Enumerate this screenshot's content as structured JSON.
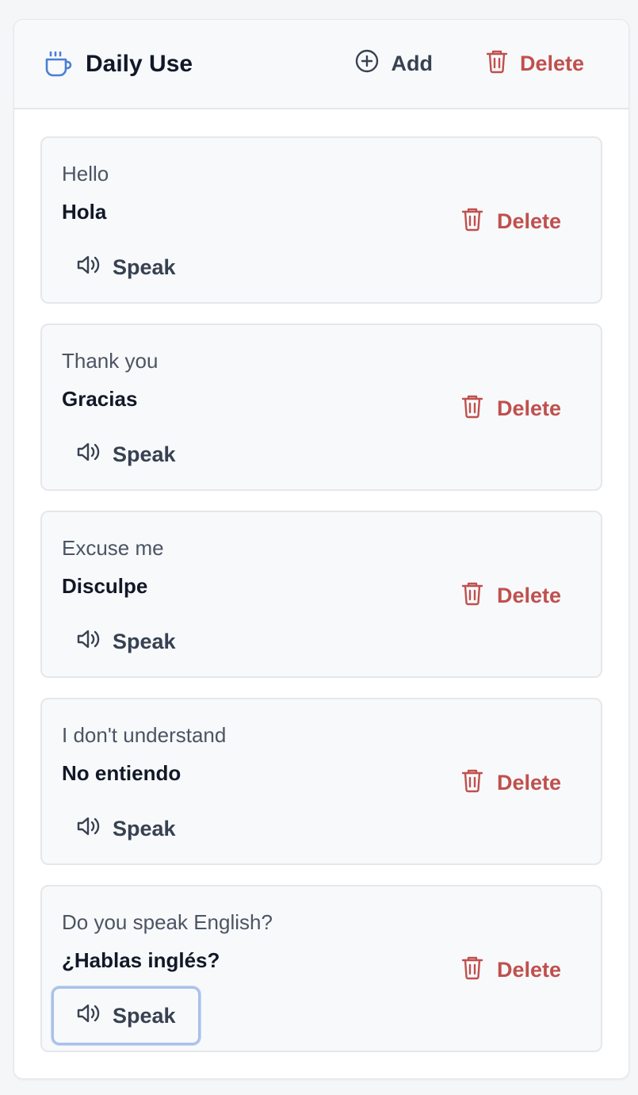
{
  "header": {
    "title": "Daily Use",
    "title_icon": "coffee-cup-icon",
    "add_label": "Add",
    "delete_label": "Delete"
  },
  "colors": {
    "accent": "#4a7fd4",
    "danger": "#c0504d",
    "text": "#111827",
    "muted": "#4b5563"
  },
  "phrases": [
    {
      "english": "Hello",
      "spanish": "Hola",
      "speak_label": "Speak",
      "delete_label": "Delete"
    },
    {
      "english": "Thank you",
      "spanish": "Gracias",
      "speak_label": "Speak",
      "delete_label": "Delete"
    },
    {
      "english": "Excuse me",
      "spanish": "Disculpe",
      "speak_label": "Speak",
      "delete_label": "Delete"
    },
    {
      "english": "I don't understand",
      "spanish": "No entiendo",
      "speak_label": "Speak",
      "delete_label": "Delete"
    },
    {
      "english": "Do you speak English?",
      "spanish": "¿Hablas inglés?",
      "speak_label": "Speak",
      "delete_label": "Delete",
      "focused": true
    }
  ]
}
